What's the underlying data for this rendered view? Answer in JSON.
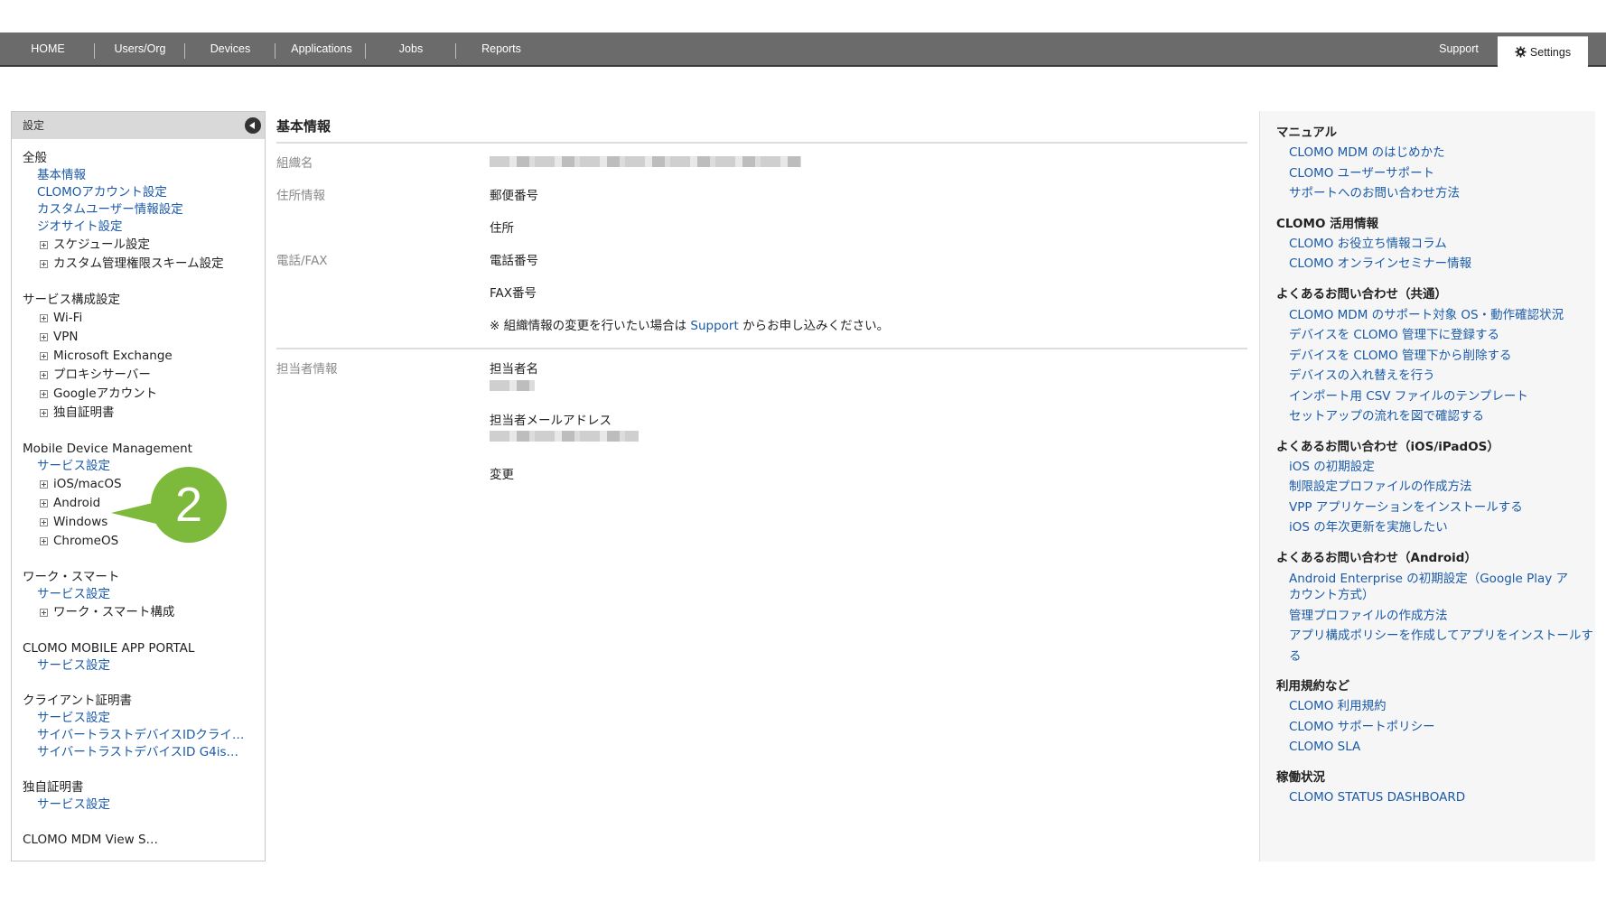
{
  "nav": {
    "items": [
      "HOME",
      "Users/Org",
      "Devices",
      "Applications",
      "Jobs",
      "Reports"
    ],
    "support": "Support",
    "settings": "Settings"
  },
  "sidebar": {
    "header": "設定",
    "groups": [
      {
        "title": "全般",
        "links": [
          "基本情報",
          "CLOMOアカウント設定",
          "カスタムユーザー情報設定",
          "ジオサイト設定"
        ],
        "expandables": [
          "スケジュール設定",
          "カスタム管理権限スキーム設定"
        ]
      },
      {
        "title": "サービス構成設定",
        "links": [],
        "expandables": [
          "Wi-Fi",
          "VPN",
          "Microsoft Exchange",
          "プロキシサーバー",
          "Googleアカウント",
          "独自証明書"
        ]
      },
      {
        "title": "Mobile Device Management",
        "links": [
          "サービス設定"
        ],
        "expandables": [
          "iOS/macOS",
          "Android",
          "Windows",
          "ChromeOS"
        ]
      },
      {
        "title": "ワーク・スマート",
        "links": [
          "サービス設定"
        ],
        "expandables": [
          "ワーク・スマート構成"
        ]
      },
      {
        "title": "CLOMO MOBILE APP PORTAL",
        "links": [
          "サービス設定"
        ],
        "expandables": []
      },
      {
        "title": "クライアント証明書",
        "links": [
          "サービス設定",
          "サイバートラストデバイスIDクライ…",
          "サイバートラストデバイスID G4is…"
        ],
        "expandables": []
      },
      {
        "title": "独自証明書",
        "links": [
          "サービス設定"
        ],
        "expandables": []
      },
      {
        "title": "CLOMO MDM View S…",
        "links": [],
        "expandables": []
      }
    ]
  },
  "badge": "2",
  "main": {
    "title": "基本情報",
    "org_label": "組織名",
    "address_label": "住所情報",
    "postal_label": "郵便番号",
    "address_field": "住所",
    "phone_label": "電話/FAX",
    "phone_field": "電話番号",
    "fax_field": "FAX番号",
    "note_prefix": "※ 組織情報の変更を行いたい場合は ",
    "note_link": "Support",
    "note_suffix": " からお申し込みください。",
    "contact_label": "担当者情報",
    "contact_name_field": "担当者名",
    "contact_email_field": "担当者メールアドレス",
    "change_link": "変更"
  },
  "right": {
    "sections": [
      {
        "heading": "マニュアル",
        "links": [
          "CLOMO MDM のはじめかた",
          "CLOMO ユーザーサポート",
          "サポートへのお問い合わせ方法"
        ]
      },
      {
        "heading": "CLOMO 活用情報",
        "links": [
          "CLOMO お役立ち情報コラム",
          "CLOMO オンラインセミナー情報"
        ]
      },
      {
        "heading": "よくあるお問い合わせ（共通）",
        "links": [
          "CLOMO MDM のサポート対象 OS・動作確認状況",
          "デバイスを CLOMO 管理下に登録する",
          "デバイスを CLOMO 管理下から削除する",
          "デバイスの入れ替えを行う",
          "インポート用 CSV ファイルのテンプレート",
          "セットアップの流れを図で確認する"
        ]
      },
      {
        "heading": "よくあるお問い合わせ（iOS/iPadOS）",
        "links": [
          "iOS の初期設定",
          "制限設定プロファイルの作成方法",
          "VPP アプリケーションをインストールする",
          "iOS の年次更新を実施したい"
        ]
      },
      {
        "heading": "よくあるお問い合わせ（Android）",
        "links": [
          "Android Enterprise の初期設定（Google Play アカウント方式）",
          "管理プロファイルの作成方法",
          "アプリ構成ポリシーを作成してアプリをインストールする"
        ]
      },
      {
        "heading": "利用規約など",
        "links": [
          "CLOMO 利用規約",
          "CLOMO サポートポリシー",
          "CLOMO SLA"
        ]
      },
      {
        "heading": "稼働状況",
        "links": [
          "CLOMO STATUS DASHBOARD"
        ]
      }
    ]
  }
}
